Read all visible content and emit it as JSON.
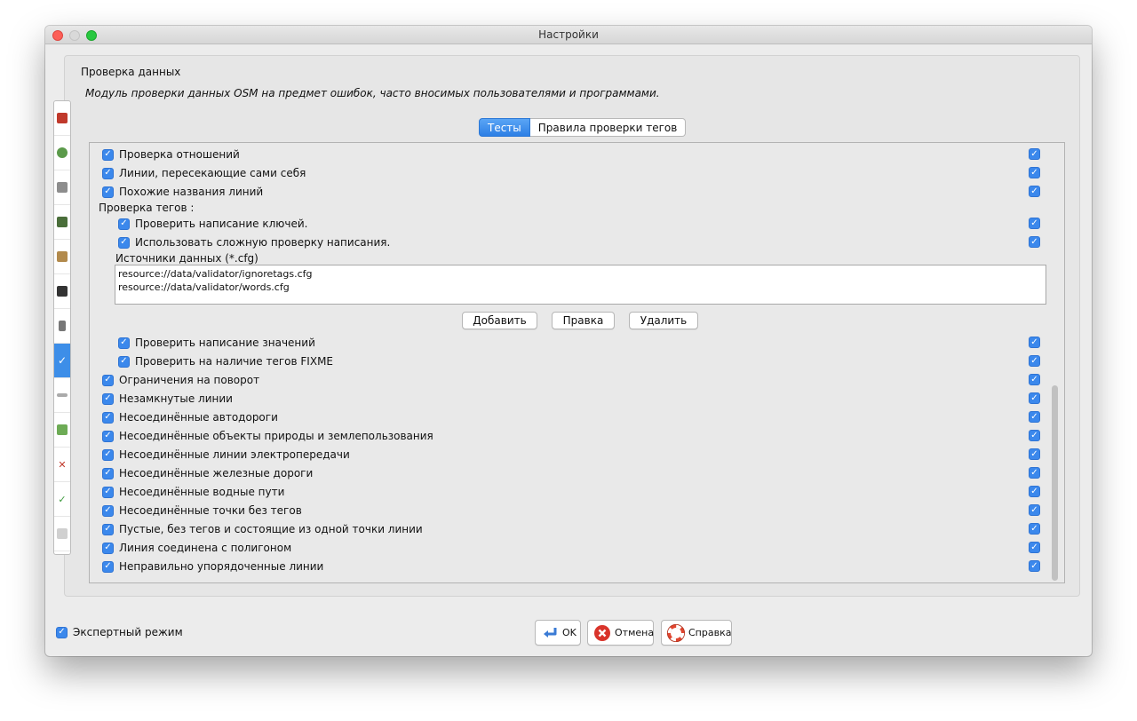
{
  "window": {
    "title": "Настройки"
  },
  "section": {
    "title": "Проверка данных",
    "description": "Модуль проверки данных OSM на предмет ошибок, часто вносимых пользователями и программами."
  },
  "tabs": [
    {
      "label": "Тесты",
      "active": true
    },
    {
      "label": "Правила проверки тегов",
      "active": false
    }
  ],
  "tests_top": [
    {
      "label": "Проверка отношений",
      "checked": true
    },
    {
      "label": "Линии, пересекающие сами себя",
      "checked": true
    },
    {
      "label": "Похожие названия линий",
      "checked": true
    }
  ],
  "tag_check": {
    "group_label": "Проверка тегов :",
    "options": [
      {
        "label": "Проверить написание ключей.",
        "checked": true
      },
      {
        "label": "Использовать сложную проверку написания.",
        "checked": true
      }
    ],
    "sources_label": "Источники данных (*.cfg)",
    "sources": [
      "resource://data/validator/ignoretags.cfg",
      "resource://data/validator/words.cfg"
    ],
    "buttons": {
      "add": "Добавить",
      "edit": "Правка",
      "delete": "Удалить"
    },
    "options2": [
      {
        "label": "Проверить написание значений",
        "checked": true
      },
      {
        "label": "Проверить на наличие тегов FIXME",
        "checked": true
      }
    ]
  },
  "tests_bottom": [
    {
      "label": "Ограничения на поворот",
      "checked": true
    },
    {
      "label": "Незамкнутые линии",
      "checked": true
    },
    {
      "label": "Несоединённые автодороги",
      "checked": true
    },
    {
      "label": "Несоединённые объекты природы и землепользования",
      "checked": true
    },
    {
      "label": "Несоединённые линии электропередачи",
      "checked": true
    },
    {
      "label": "Несоединённые железные дороги",
      "checked": true
    },
    {
      "label": "Несоединённые водные пути",
      "checked": true
    },
    {
      "label": "Несоединённые точки без тегов",
      "checked": true
    },
    {
      "label": "Пустые, без тегов и состоящие из одной точки линии",
      "checked": true
    },
    {
      "label": "Линия соединена с полигоном",
      "checked": true
    },
    {
      "label": "Неправильно упорядоченные линии",
      "checked": true
    }
  ],
  "footer": {
    "expert_mode": "Экспертный режим",
    "ok": "OK",
    "cancel": "Отмена",
    "help": "Справка"
  },
  "colors": {
    "accent": "#3b88ec",
    "window_bg": "#ececec",
    "panel_bg": "#e9e9e9"
  },
  "sidebar_icons": [
    "display-settings-icon",
    "connection-icon",
    "map-settings-icon",
    "projection-icon",
    "remote-control-icon",
    "plugins-icon",
    "shortcuts-icon",
    "validator-icon",
    "audio-icon",
    "imagery-icon",
    "filter-icon",
    "map-paint-icon",
    "advanced-icon"
  ]
}
